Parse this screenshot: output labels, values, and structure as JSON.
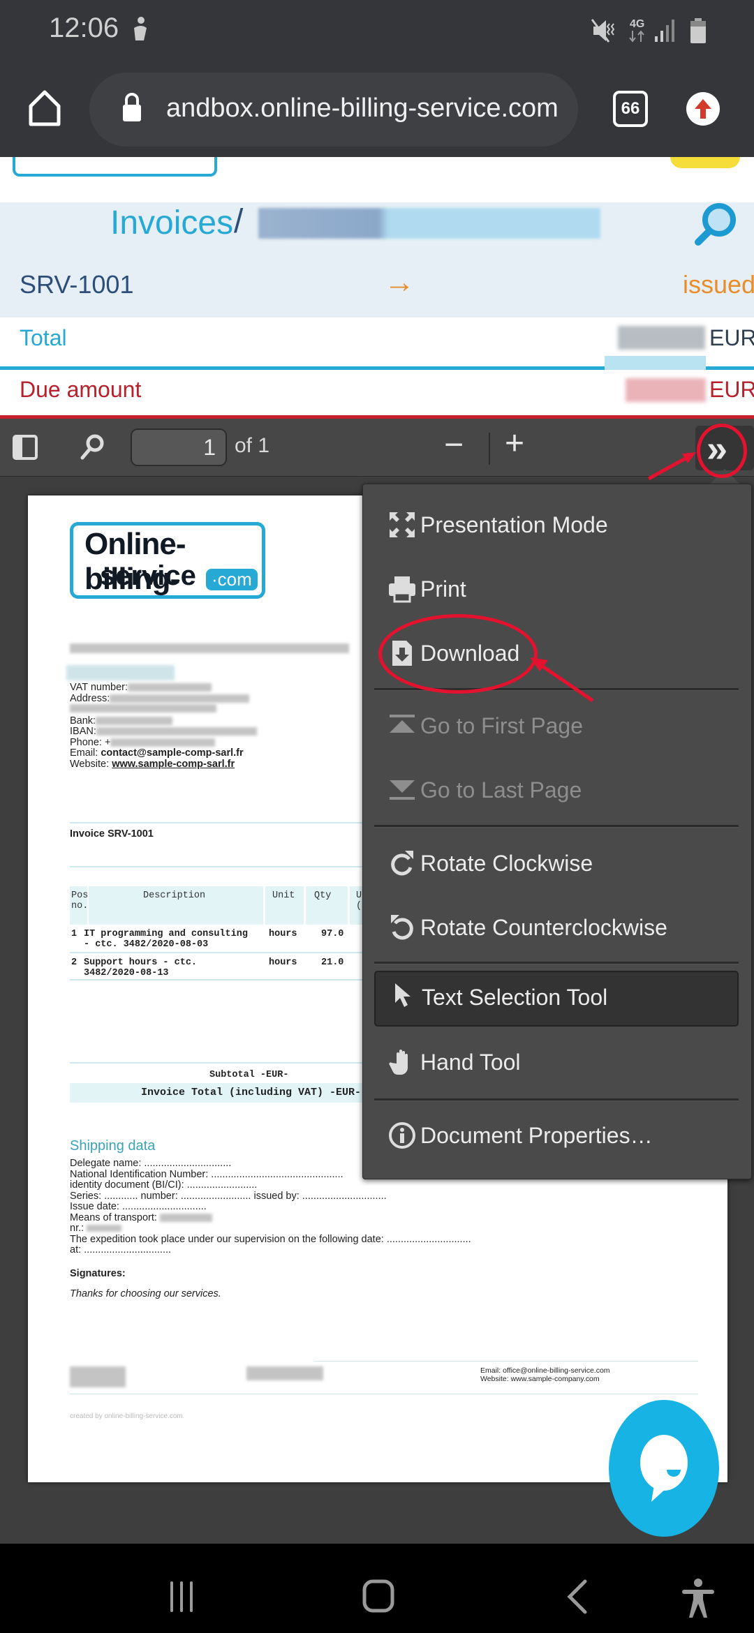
{
  "status_bar": {
    "time": "12:06",
    "network": "4G",
    "icons": [
      "accessibility-notification-icon",
      "mute-icon",
      "4g-icon",
      "signal-icon",
      "battery-icon"
    ]
  },
  "browser": {
    "url": "andbox.online-billing-service.com",
    "tab_count": "66",
    "icons": [
      "home-icon",
      "lock-icon",
      "tabs-icon",
      "update-icon"
    ]
  },
  "site": {
    "breadcrumb": {
      "root": "Invoices",
      "separator": "/",
      "current": "[redacted]"
    },
    "invoice_id": "SRV-1001",
    "arrow": "→",
    "status": "issued",
    "total_label": "Total",
    "total_currency": "EUR",
    "due_label": "Due amount",
    "due_currency": "EUR",
    "colors": {
      "accent": "#27a9d6",
      "navy": "#2d4d7a",
      "orange": "#e98d2b",
      "danger": "#b8202b"
    }
  },
  "pdf_toolbar": {
    "page_value": "1",
    "page_total": "of 1",
    "zoom_out": "−",
    "zoom_in": "+",
    "tools": "»"
  },
  "menu": {
    "items": [
      {
        "label": "Presentation Mode",
        "icon": "presentation-mode-icon",
        "disabled": false
      },
      {
        "label": "Print",
        "icon": "print-icon",
        "disabled": false
      },
      {
        "label": "Download",
        "icon": "download-icon",
        "disabled": false
      },
      {
        "label": "Go to First Page",
        "icon": "first-page-icon",
        "disabled": true
      },
      {
        "label": "Go to Last Page",
        "icon": "last-page-icon",
        "disabled": true
      },
      {
        "label": "Rotate Clockwise",
        "icon": "rotate-cw-icon",
        "disabled": false
      },
      {
        "label": "Rotate Counterclockwise",
        "icon": "rotate-ccw-icon",
        "disabled": false
      },
      {
        "label": "Text Selection Tool",
        "icon": "cursor-icon",
        "disabled": false,
        "active": true
      },
      {
        "label": "Hand Tool",
        "icon": "hand-icon",
        "disabled": false
      },
      {
        "label": "Document Properties…",
        "icon": "info-icon",
        "disabled": false
      }
    ]
  },
  "document": {
    "logo_line1": "Online-billing-",
    "logo_line2": "service",
    "logo_com": "·com",
    "company_fields": [
      {
        "label": "VAT number:",
        "value": ""
      },
      {
        "label": "Address:",
        "value": ""
      },
      {
        "label": "Bank:",
        "value": ""
      },
      {
        "label": "IBAN:",
        "value": ""
      },
      {
        "label": "Phone: +",
        "value": ""
      }
    ],
    "email_label": "Email:",
    "email": "contact@sample-comp-sarl.fr",
    "website_label": "Website:",
    "website": "www.sample-comp-sarl.fr",
    "invoice_title": "Invoice SRV-1001",
    "table": {
      "headers": [
        "Pos no.",
        "Description",
        "Unit",
        "Qty",
        "U ("
      ],
      "rows": [
        {
          "pos": "1",
          "description": "IT programming and consulting - ctc. 3482/2020-08-03",
          "unit": "hours",
          "qty": "97.0"
        },
        {
          "pos": "2",
          "description": "Support hours - ctc. 3482/2020-08-13",
          "unit": "hours",
          "qty": "21.0"
        }
      ]
    },
    "subtotal_label": "Subtotal -EUR-",
    "invoice_total_label": "Invoice Total (including VAT) -EUR-",
    "shipping_title": "Shipping data",
    "shipping_lines": [
      "Delegate name: ...............................",
      "National Identification Number: ...............................................",
      "identity document (BI/CI): .........................",
      "Series: ............ number: ......................... issued by: ..............................",
      "Issue date: ..............................",
      "Means of transport:",
      "nr.:",
      "The expedition took place under our supervision on the following date: ..............................",
      "at: ..............................."
    ],
    "signatures": "Signatures:",
    "thanks": "Thanks for choosing our services.",
    "footer_email": "Email: office@online-billing-service.com",
    "footer_website": "Website: www.sample-company.com",
    "created_by": "created by online-billing-service.com"
  },
  "nav_bar": {
    "icons": [
      "recents-icon",
      "home-icon",
      "back-icon",
      "accessibility-icon"
    ]
  }
}
